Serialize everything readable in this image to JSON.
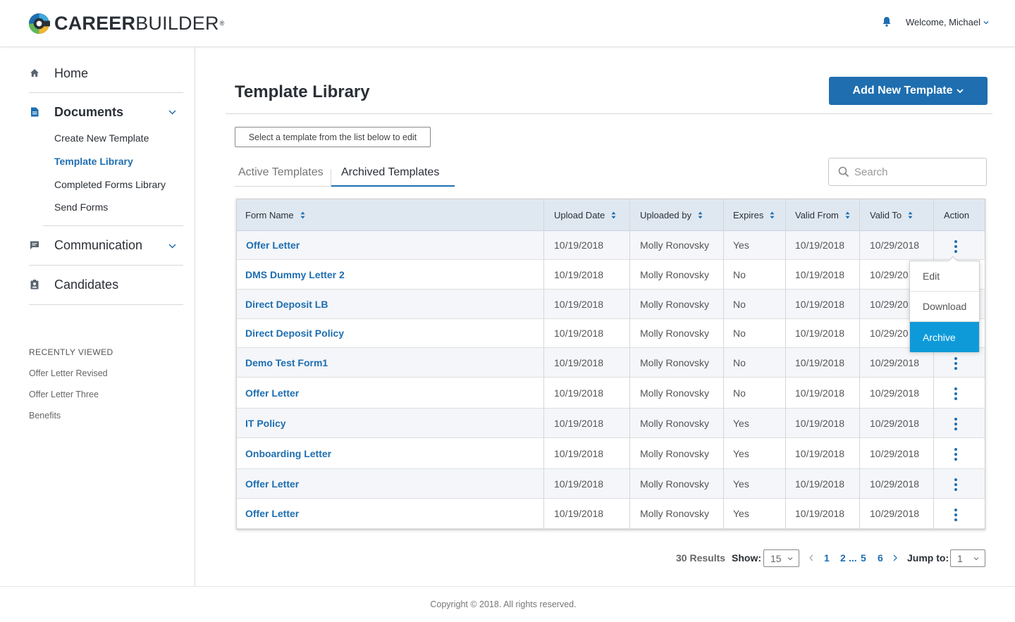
{
  "header": {
    "logo_bold": "CAREER",
    "logo_light": "BUILDER",
    "logo_reg": "®",
    "welcome": "Welcome, Michael"
  },
  "sidebar": {
    "home": "Home",
    "documents": "Documents",
    "documents_items": [
      "Create New Template",
      "Template Library",
      "Completed Forms Library",
      "Send Forms"
    ],
    "communication": "Communication",
    "candidates": "Candidates",
    "recent_title": "RECENTLY VIEWED",
    "recent_items": [
      "Offer Letter Revised",
      "Offer Letter Three",
      "Benefits"
    ]
  },
  "main": {
    "title": "Template Library",
    "add_button": "Add New Template",
    "hint": "Select a template from the list below to edit",
    "tabs": [
      "Active Templates",
      "Archived Templates"
    ],
    "search_placeholder": "Search"
  },
  "table": {
    "columns": [
      "Form Name",
      "Upload Date",
      "Uploaded by",
      "Expires",
      "Valid From",
      "Valid To",
      "Action"
    ],
    "rows": [
      {
        "name": "Offer Letter",
        "upload": "10/19/2018",
        "by": "Molly Ronovsky",
        "expires": "Yes",
        "from": "10/19/2018",
        "to": "10/29/2018"
      },
      {
        "name": "DMS Dummy Letter 2",
        "upload": "10/19/2018",
        "by": "Molly Ronovsky",
        "expires": "No",
        "from": "10/19/2018",
        "to": "10/29/20"
      },
      {
        "name": "Direct Deposit LB",
        "upload": "10/19/2018",
        "by": "Molly Ronovsky",
        "expires": "No",
        "from": "10/19/2018",
        "to": "10/29/20"
      },
      {
        "name": "Direct Deposit Policy",
        "upload": "10/19/2018",
        "by": "Molly Ronovsky",
        "expires": "No",
        "from": "10/19/2018",
        "to": "10/29/20"
      },
      {
        "name": "Demo Test Form1",
        "upload": "10/19/2018",
        "by": "Molly Ronovsky",
        "expires": "No",
        "from": "10/19/2018",
        "to": "10/29/2018"
      },
      {
        "name": "Offer Letter",
        "upload": "10/19/2018",
        "by": "Molly Ronovsky",
        "expires": "No",
        "from": "10/19/2018",
        "to": "10/29/2018"
      },
      {
        "name": "IT Policy",
        "upload": "10/19/2018",
        "by": "Molly Ronovsky",
        "expires": "Yes",
        "from": "10/19/2018",
        "to": "10/29/2018"
      },
      {
        "name": "Onboarding Letter",
        "upload": "10/19/2018",
        "by": "Molly Ronovsky",
        "expires": "Yes",
        "from": "10/19/2018",
        "to": "10/29/2018"
      },
      {
        "name": "Offer Letter",
        "upload": "10/19/2018",
        "by": "Molly Ronovsky",
        "expires": "Yes",
        "from": "10/19/2018",
        "to": "10/29/2018"
      },
      {
        "name": "Offer Letter",
        "upload": "10/19/2018",
        "by": "Molly Ronovsky",
        "expires": "Yes",
        "from": "10/19/2018",
        "to": "10/29/2018"
      }
    ],
    "action_menu": [
      "Edit",
      "Download",
      "Archive"
    ]
  },
  "pagination": {
    "results": "30 Results",
    "show_label": "Show:",
    "show_value": "15",
    "pages": [
      "1",
      "2",
      "...",
      "5",
      "6"
    ],
    "jump_label": "Jump to:",
    "jump_value": "1"
  },
  "footer": {
    "copyright": "Copyright © 2018. All rights reserved."
  },
  "colors": {
    "brand_blue": "#1e6eb0",
    "accent_cyan": "#0e9ad9",
    "header_row": "#dfe8f1"
  }
}
